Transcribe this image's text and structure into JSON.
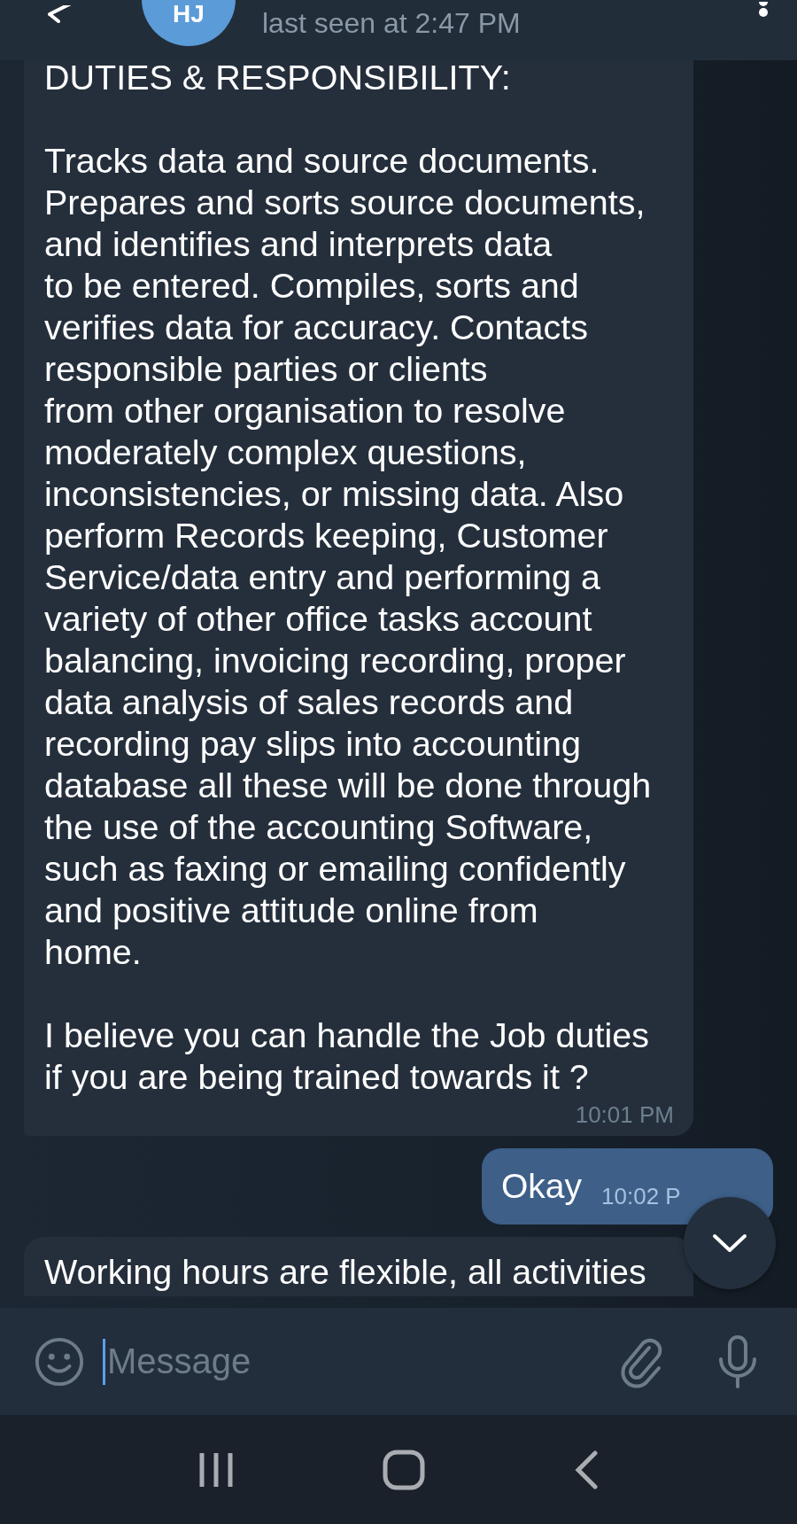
{
  "header": {
    "avatar_initials": "HJ",
    "status": "last seen at 2:47 PM"
  },
  "messages": [
    {
      "kind": "incoming",
      "text": "DUTIES & RESPONSIBILITY:\n\nTracks data and source documents.\nPrepares and sorts source documents,\nand identifies and interprets data\nto be entered. Compiles, sorts and\nverifies data for accuracy. Contacts\nresponsible parties or clients\nfrom other organisation to resolve\nmoderately complex questions,\ninconsistencies, or missing data. Also\nperform Records keeping, Customer\nService/data entry and performing a\nvariety of other office tasks account\nbalancing, invoicing recording, proper\ndata analysis of sales records and\nrecording pay slips into accounting\ndatabase all these will be done through\nthe use of the accounting Software,\nsuch as faxing or emailing confidently\nand positive attitude online from\nhome.\n\nI believe you can handle the Job duties\nif you are being trained towards it ?",
      "time": "10:01 PM"
    },
    {
      "kind": "outgoing",
      "text": "Okay",
      "time": "10:02 P"
    },
    {
      "kind": "incoming",
      "text": "Working hours are flexible, all activities"
    }
  ],
  "composer": {
    "placeholder": "Message"
  }
}
